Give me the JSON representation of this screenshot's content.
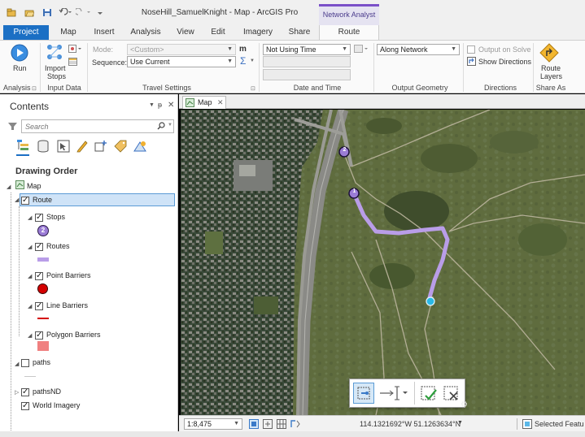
{
  "window": {
    "title": "NoseHill_SamuelKnight - Map - ArcGIS Pro",
    "context_tab_group": "Network Analyst"
  },
  "tabs": [
    "Project",
    "Map",
    "Insert",
    "Analysis",
    "View",
    "Edit",
    "Imagery",
    "Share",
    "Route"
  ],
  "active_tab": "Route",
  "ribbon": {
    "analysis": {
      "run_label": "Run",
      "group_label": "Analysis"
    },
    "input_data": {
      "import_label": "Import",
      "stops_label": "Stops",
      "group_label": "Input Data"
    },
    "travel_settings": {
      "mode_label": "Mode:",
      "mode_value": "<Custom>",
      "sequence_label": "Sequence:",
      "sequence_value": "Use Current",
      "unit_label": "m",
      "sum_symbol": "Σ",
      "group_label": "Travel Settings"
    },
    "date_time": {
      "time_value": "Not Using Time",
      "group_label": "Date and Time"
    },
    "output_geometry": {
      "value": "Along Network",
      "group_label": "Output Geometry"
    },
    "directions": {
      "output_on_solve": "Output on Solve",
      "show_directions": "Show Directions",
      "group_label": "Directions"
    },
    "share_as": {
      "route_label": "Route",
      "layers_label": "Layers",
      "group_label": "Share As"
    }
  },
  "contents": {
    "title": "Contents",
    "search_placeholder": "Search",
    "section_title": "Drawing Order",
    "layers": {
      "map": "Map",
      "route": "Route",
      "stops": "Stops",
      "stop_symbol_number": "2",
      "routes": "Routes",
      "point_barriers": "Point Barriers",
      "line_barriers": "Line Barriers",
      "polygon_barriers": "Polygon Barriers",
      "paths": "paths",
      "pathsnd": "pathsND",
      "world_imagery": "World Imagery"
    }
  },
  "map": {
    "tab_label": "Map",
    "stop_labels": [
      "1",
      "2"
    ],
    "scale": "1:8,475",
    "coordinates": "114.1321692°W 51.1263634°N",
    "selected_features": "Selected Featu"
  },
  "colors": {
    "accent_blue": "#1b6fc4",
    "route_purple": "#b99de8",
    "stop_purple": "#9b7cd6",
    "point_barrier_red": "#d40000",
    "polygon_barrier": "#f08080",
    "endpoint_cyan": "#2ab8e6"
  }
}
